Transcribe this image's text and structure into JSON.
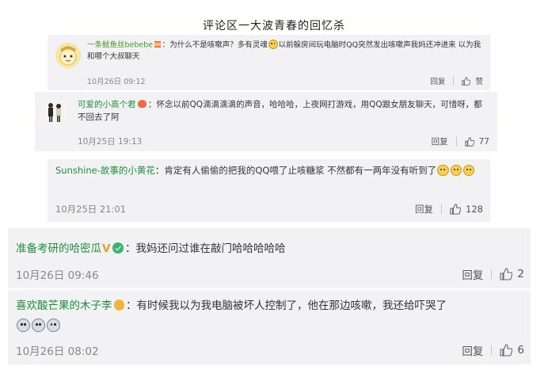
{
  "page_title": "评论区一大波青春的回忆杀",
  "comments": [
    {
      "username": "一条鱿鱼丝bebebe",
      "text": "：为什么不是咳嗽声？多有灵魂",
      "text2": "以前躲房间玩电脑时QQ突然发出咳嗽声我妈还冲进来 以为我和哪个大叔聊天",
      "time": "10月26日 09:12",
      "reply_label": "回复",
      "like_label": "赞"
    },
    {
      "username": "可爱的小高个君",
      "text": "：怀念以前QQ滴滴滴滴的声音，哈哈哈，上夜网打游戏，用QQ跟女朋友聊天，可惜呀，都不回去了阿",
      "time": "10月25日 19:13",
      "reply_label": "回复",
      "like_count": "77"
    },
    {
      "username": "Sunshine-故事的小黄花",
      "text": "：肯定有人偷偷的把我的QQ喂了止咳糖浆 不然都有一两年没有听到了",
      "time": "10月25日 21:01",
      "reply_label": "回复",
      "like_count": "128"
    },
    {
      "username": "准备考研的哈密瓜",
      "text": "：我妈还问过谁在敲门哈哈哈哈哈",
      "time": "10月26日 09:46",
      "reply_label": "回复",
      "like_count": "2"
    },
    {
      "username": "喜欢酸芒果的木子李",
      "text": "：有时候我以为我电脑被坏人控制了，他在那边咳嗽，我还给吓哭了",
      "time": "10月26日 08:02",
      "reply_label": "回复",
      "like_count": "6"
    }
  ],
  "colors": {
    "username": "#1e8f3a",
    "card_bg": "#f2f2f5",
    "meta": "#888888"
  },
  "icons": [
    "thumbs-up-icon",
    "vip-v-icon",
    "verified-icon",
    "medal-icon",
    "hourglass-icon",
    "fire-icon",
    "smile-emoji",
    "cry-emoji"
  ]
}
